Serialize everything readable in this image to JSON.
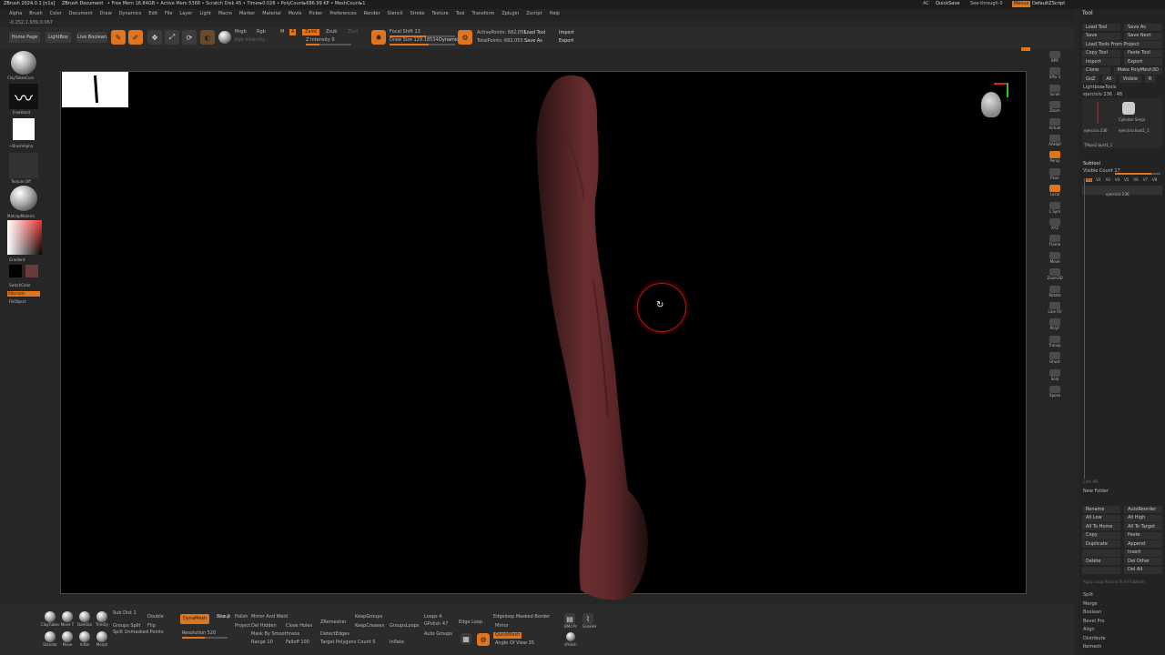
{
  "titlebar": {
    "app": "ZBrush 2024.0.1 [n1s]",
    "document": "ZBrush Document",
    "stats": "• Free Mem 16.84GB • Active Mem 5368 • Scratch Disk 45 • Timer▸0.026 • PolyCount▸686.99 KP • MeshCount▸1",
    "ac": "AC",
    "quicksave": "QuickSave",
    "seethrough": "See-through 0",
    "menus": "Menus",
    "defaultscript": "DefaultZScript"
  },
  "menubar": [
    "Alpha",
    "Brush",
    "Color",
    "Document",
    "Draw",
    "Dynamics",
    "Edit",
    "File",
    "Layer",
    "Light",
    "Macro",
    "Marker",
    "Material",
    "Movie",
    "Picker",
    "Preferences",
    "Render",
    "Stencil",
    "Stroke",
    "Texture",
    "Tool",
    "Transform",
    "Zplugin",
    "Zscript",
    "Help"
  ],
  "infobar": {
    "coords": "-0.252,1.939,0.067"
  },
  "topshelf": {
    "home": "Home Page",
    "lightbox": "LightBox",
    "liveboolean": "Live Boolean",
    "edit": "Edit",
    "draw": "Draw",
    "move": "Move",
    "scale": "Scale",
    "rotate": "Rotate",
    "mrgb": "Mrgb",
    "rgb": "Rgb",
    "m": "M",
    "zadd": "Zadd",
    "zsub": "Zsub",
    "zcut": "Zcut",
    "rgbintensity": "Rgb Intensity",
    "zintensity": "Z Intensity 9",
    "focal": "Focal Shift 13",
    "drawsize": "Draw Size 129.18534",
    "dynamic": "Dynamic",
    "activepoints": "ActivePoints: 682,055",
    "totalpoints": "TotalPoints: 682,055",
    "loadtool": "Load Tool",
    "saveas": "Save As",
    "import": "Import",
    "export": "Export"
  },
  "leftshelf": {
    "brush": "ClayTubesCurv",
    "stroke": "FreeHand",
    "alpha": "~BrushAlpha",
    "texture": "Texture Off",
    "material": "MatcapMateria",
    "gradient": "Gradient",
    "switchcolor": "SwitchColor",
    "alternate": "Alternate",
    "fillobject": "FillObject"
  },
  "rightshelf": [
    "BPR",
    "SPix 3",
    "Scroll",
    "Zoom",
    "Actual",
    "AAHalf",
    "Persp",
    "Floor",
    "Local",
    "L.Sym",
    "XYZ",
    "Frame",
    "Move",
    "Zoom3D",
    "Rotate",
    "Line Fill",
    "PolyF",
    "Transp",
    "Ghost",
    "Solo",
    "Xpose"
  ],
  "toolpanel": {
    "header": "Tool",
    "buttons": [
      [
        "Load Tool",
        "Save As"
      ],
      [
        "Save",
        "Save Next"
      ],
      [
        "Load Tools From Project",
        ""
      ],
      [
        "Copy Tool",
        "Paste Tool"
      ],
      [
        "Import",
        "Export"
      ],
      [
        "Clone",
        "Make PolyMesh3D"
      ],
      [
        "GoZ",
        "All",
        "Visible",
        "R"
      ]
    ],
    "lightbox": "Lightbox▸Tools",
    "current": "ejercicio 236 . 48",
    "thumbs": [
      "ejercicio 236",
      "Cylinder Simpl",
      "ejercicio 236",
      "ejercicio bust1_1",
      "TPose2 bust1_1"
    ],
    "subtool": "Subtool",
    "visiblecount": "Visible Count 17",
    "vs": [
      "V1",
      "V2",
      "V3",
      "V4",
      "V5",
      "V6",
      "V7",
      "V8"
    ],
    "item": "ejercicio 236",
    "listall": "List All",
    "newfolder": "New Folder",
    "actions": [
      [
        "Rename",
        "AutoReorder"
      ],
      [
        "All Low",
        "All High"
      ],
      [
        "All To Home",
        "All To Target"
      ],
      [
        "Copy",
        "Paste"
      ],
      [
        "Duplicate",
        "Append"
      ],
      [
        "",
        "Insert"
      ],
      [
        "Delete",
        "Del Other"
      ],
      [
        "",
        "Del All"
      ]
    ],
    "applyall": "Apply Loop Actions To All Subtools",
    "split": [
      "Split",
      "Merge",
      "Boolean",
      "Bevel Pro",
      "Align",
      "Distribute",
      "Remesh"
    ]
  },
  "bottom": {
    "brushes": [
      "ClayTubes",
      "Move T",
      "DamSta",
      "TrimDy",
      "Standar",
      "Move",
      "Inflat",
      "Morph"
    ],
    "col1": [
      "Sub Dist 1",
      "Double",
      "Flip",
      "Groups Split",
      "Split Unmasked Points"
    ],
    "dynamesh": "DynaMesh",
    "blur": "Blur 2",
    "resolution": "Resolution 520",
    "group": "Group",
    "polish": "Polish",
    "project": "Project",
    "mirrorweld": "Mirror And Weld",
    "delhidden": "Del Hidden",
    "closeholes": "Close Holes",
    "maskbysmooth": "Mask By Smoothness",
    "range": "Range 10",
    "falloff": "Falloff 100",
    "zremesher": "ZRemesher",
    "detectedges": "DetectEdges",
    "targetpoly": "Target Polygons Count 5",
    "keepgroups": "KeepGroups",
    "keepcreases": "KeepCreases",
    "grouploops": "GroupsLoops",
    "loops": "Loops 4",
    "gpolish": "GPolish 47",
    "autogroups": "Auto Groups",
    "inflate": "Inflate",
    "edgeloop": "Edge Loop",
    "edgeloopmasked": "Edgeloop Masked Border",
    "mirror": "Mirror",
    "quickmesh": "QuickMesh",
    "angle": "Angle Of View 35",
    "bevel": "BMd Pr",
    "snakehook": "SnakeH",
    "spolish": "sPolish",
    "preview": "Preview",
    "dynamic": "Dynamic"
  },
  "colors": {
    "accent": "#e0751e",
    "skin": "#6b2e30"
  }
}
